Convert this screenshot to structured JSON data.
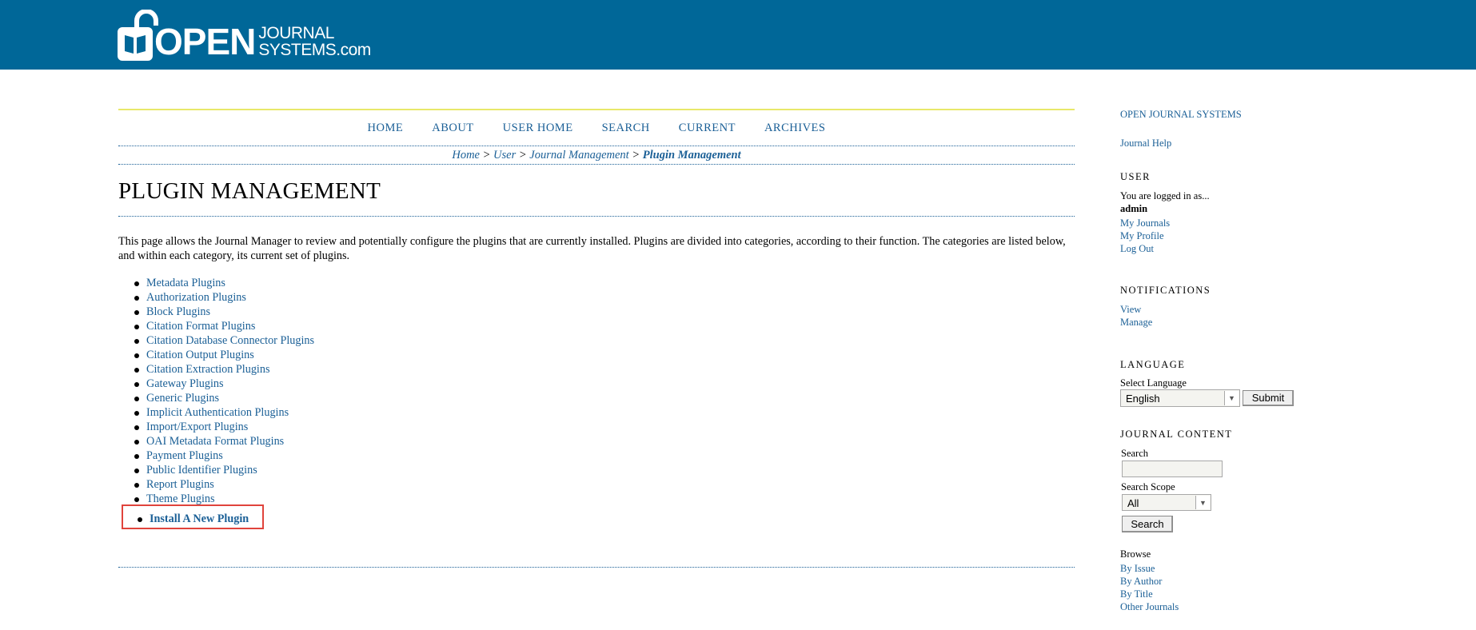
{
  "header": {
    "logo_main": "OPEN",
    "logo_sub_1": "JOURNAL",
    "logo_sub_2": "SYSTEMS.com"
  },
  "nav": [
    "HOME",
    "ABOUT",
    "USER HOME",
    "SEARCH",
    "CURRENT",
    "ARCHIVES"
  ],
  "breadcrumb": {
    "items": [
      "Home",
      "User",
      "Journal Management"
    ],
    "separator": ">",
    "current": "Plugin Management"
  },
  "page": {
    "title": "PLUGIN MANAGEMENT",
    "intro": "This page allows the Journal Manager to review and potentially configure the plugins that are currently installed. Plugins are divided into categories, according to their function. The categories are listed below, and within each category, its current set of plugins.",
    "categories": [
      "Metadata Plugins",
      "Authorization Plugins",
      "Block Plugins",
      "Citation Format Plugins",
      "Citation Database Connector Plugins",
      "Citation Output Plugins",
      "Citation Extraction Plugins",
      "Gateway Plugins",
      "Generic Plugins",
      "Implicit Authentication Plugins",
      "Import/Export Plugins",
      "OAI Metadata Format Plugins",
      "Payment Plugins",
      "Public Identifier Plugins",
      "Report Plugins",
      "Theme Plugins"
    ],
    "install_link": "Install A New Plugin"
  },
  "sidebar": {
    "ojs_link": "OPEN JOURNAL SYSTEMS",
    "help_link": "Journal Help",
    "user": {
      "title": "USER",
      "logged_in_text": "You are logged in as...",
      "username": "admin",
      "links": [
        "My Journals",
        "My Profile",
        "Log Out"
      ]
    },
    "notifications": {
      "title": "NOTIFICATIONS",
      "links": [
        "View",
        "Manage"
      ]
    },
    "language": {
      "title": "LANGUAGE",
      "select_label": "Select Language",
      "selected": "English",
      "submit_label": "Submit"
    },
    "journal_content": {
      "title": "JOURNAL CONTENT",
      "search_label": "Search",
      "search_value": "",
      "scope_label": "Search Scope",
      "scope_selected": "All",
      "search_button": "Search",
      "browse_label": "Browse",
      "browse_links": [
        "By Issue",
        "By Author",
        "By Title",
        "Other Journals"
      ]
    }
  },
  "colors": {
    "header_bg": "#006798",
    "link": "#1a5f96",
    "highlight_box": "#e0443c",
    "nav_top_rule": "#e8e86a"
  }
}
